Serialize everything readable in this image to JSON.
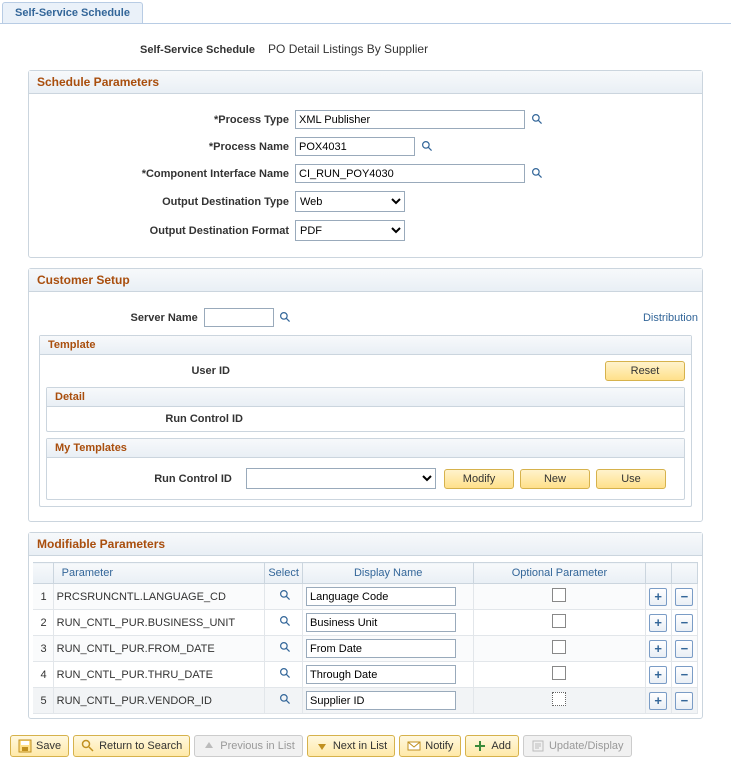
{
  "tab": {
    "title": "Self-Service Schedule"
  },
  "header": {
    "label": "Self-Service Schedule",
    "value": "PO Detail Listings By Supplier"
  },
  "schedule": {
    "title": "Schedule Parameters",
    "processTypeLabel": "*Process Type",
    "processTypeValue": "XML Publisher",
    "processNameLabel": "*Process Name",
    "processNameValue": "POX4031",
    "ciLabel": "*Component Interface Name",
    "ciValue": "CI_RUN_POY4030",
    "destTypeLabel": "Output Destination Type",
    "destTypeValue": "Web",
    "destFormatLabel": "Output Destination Format",
    "destFormatValue": "PDF"
  },
  "customer": {
    "title": "Customer Setup",
    "serverLabel": "Server Name",
    "serverValue": "",
    "distributionLink": "Distribution",
    "template": {
      "title": "Template",
      "userIdLabel": "User ID",
      "resetBtn": "Reset",
      "detail": {
        "title": "Detail",
        "runControlLabel": "Run Control ID"
      },
      "myTemplates": {
        "title": "My Templates",
        "runControlLabel": "Run Control ID",
        "modify": "Modify",
        "new": "New",
        "use": "Use"
      }
    }
  },
  "params": {
    "title": "Modifiable Parameters",
    "headers": {
      "parameter": "Parameter",
      "select": "Select",
      "display": "Display Name",
      "optional": "Optional Parameter"
    },
    "rows": [
      {
        "n": "1",
        "param": "PRCSRUNCNTL.LANGUAGE_CD",
        "display": "Language Code",
        "optDotted": false
      },
      {
        "n": "2",
        "param": "RUN_CNTL_PUR.BUSINESS_UNIT",
        "display": "Business Unit",
        "optDotted": false
      },
      {
        "n": "3",
        "param": "RUN_CNTL_PUR.FROM_DATE",
        "display": "From Date",
        "optDotted": false
      },
      {
        "n": "4",
        "param": "RUN_CNTL_PUR.THRU_DATE",
        "display": "Through Date",
        "optDotted": false
      },
      {
        "n": "5",
        "param": "RUN_CNTL_PUR.VENDOR_ID",
        "display": "Supplier ID",
        "optDotted": true
      }
    ]
  },
  "bottombar": {
    "save": "Save",
    "return": "Return to Search",
    "prev": "Previous in List",
    "next": "Next in List",
    "notify": "Notify",
    "add": "Add",
    "update": "Update/Display"
  }
}
